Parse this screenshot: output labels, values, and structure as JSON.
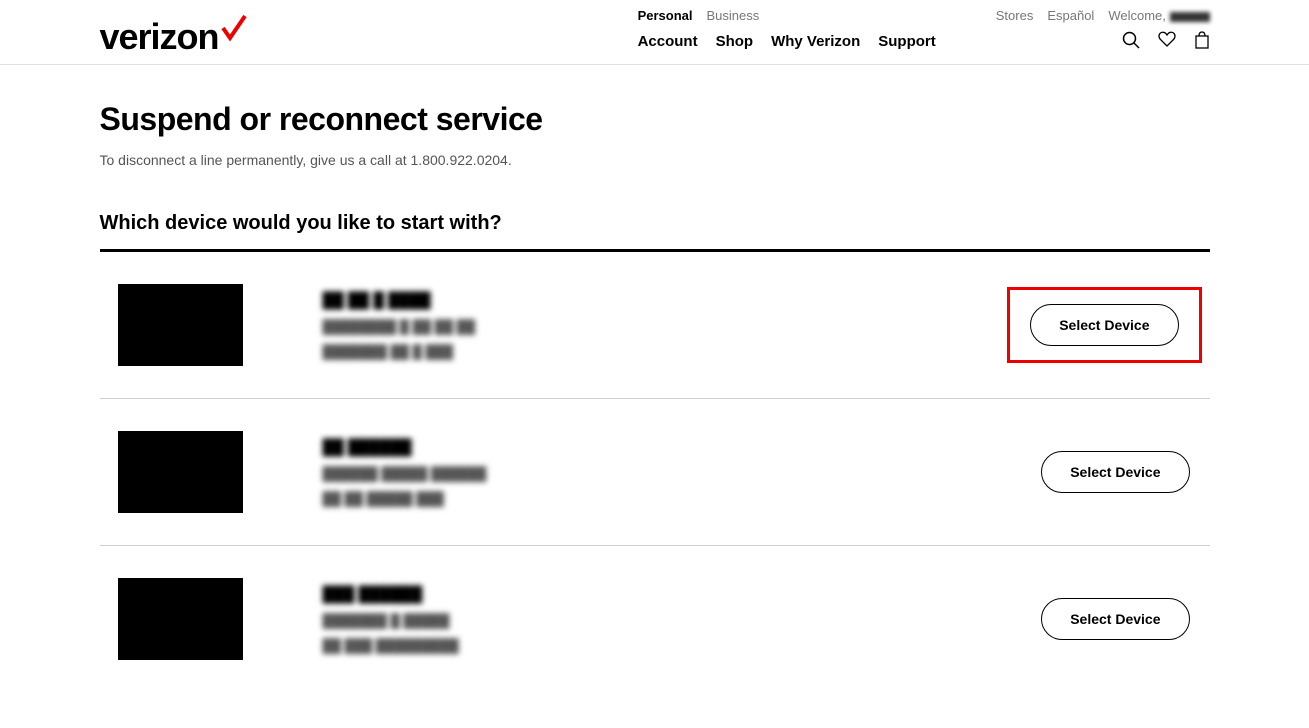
{
  "brand": {
    "name": "verizon"
  },
  "topNav": {
    "personal": "Personal",
    "business": "Business"
  },
  "mainNav": {
    "account": "Account",
    "shop": "Shop",
    "why": "Why Verizon",
    "support": "Support"
  },
  "utilNav": {
    "stores": "Stores",
    "espanol": "Español",
    "welcome": "Welcome,"
  },
  "page": {
    "title": "Suspend or reconnect service",
    "subtitle": "To disconnect a line permanently, give us a call at 1.800.922.0204.",
    "sectionTitle": "Which device would you like to start with?",
    "selectLabel": "Select Device"
  },
  "devices": [
    {
      "name": "██ ██ █ ████",
      "line1": "████████ █ ██ ██ ██",
      "line2": "███████ ██ █ ███"
    },
    {
      "name": "██ ██████",
      "line1": "██████ █████ ██████",
      "line2": "██ ██ █████ ███"
    },
    {
      "name": "███ ██████",
      "line1": "███████ █ █████",
      "line2": "██ ███ █████████"
    }
  ]
}
